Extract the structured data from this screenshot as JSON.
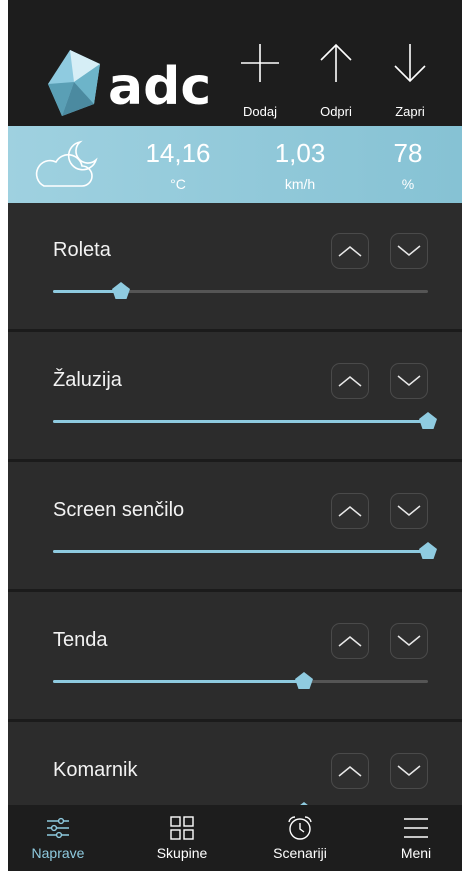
{
  "header": {
    "logo_text": "adc",
    "buttons": [
      {
        "label": "Dodaj",
        "icon": "plus-icon"
      },
      {
        "label": "Odpri",
        "icon": "arrow-up-icon"
      },
      {
        "label": "Zapri",
        "icon": "arrow-down-icon"
      }
    ]
  },
  "weather": {
    "icon": "cloud-moon-icon",
    "temperature": {
      "value": "14,16",
      "unit": "°C"
    },
    "wind": {
      "value": "1,03",
      "unit": "km/h"
    },
    "humidity": {
      "value": "78",
      "unit": "%"
    }
  },
  "devices": [
    {
      "name": "Roleta",
      "position": 0.18
    },
    {
      "name": "Žaluzija",
      "position": 1.0
    },
    {
      "name": "Screen senčilo",
      "position": 1.0
    },
    {
      "name": "Tenda",
      "position": 0.67
    },
    {
      "name": "Komarnik",
      "position": 0.67
    }
  ],
  "nav": [
    {
      "label": "Naprave",
      "icon": "sliders-icon",
      "active": true
    },
    {
      "label": "Skupine",
      "icon": "grid-icon",
      "active": false
    },
    {
      "label": "Scenariji",
      "icon": "alarm-clock-icon",
      "active": false
    },
    {
      "label": "Meni",
      "icon": "menu-icon",
      "active": false
    }
  ],
  "colors": {
    "accent": "#8fcbe0",
    "background": "#2c2c2c",
    "header": "#1d1d1d"
  }
}
